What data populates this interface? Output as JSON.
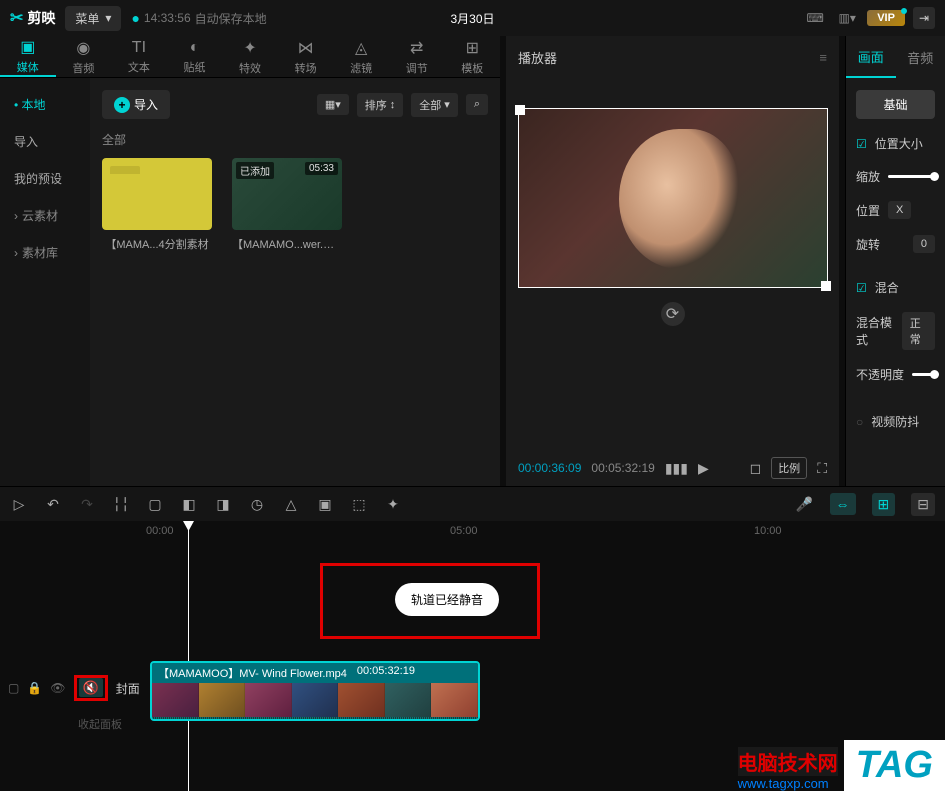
{
  "topbar": {
    "app_name": "剪映",
    "menu_label": "菜单",
    "autosave_time": "14:33:56",
    "autosave_text": "自动保存本地",
    "date": "3月30日",
    "vip": "VIP"
  },
  "tabs": [
    {
      "icon": "▣",
      "label": "媒体"
    },
    {
      "icon": "◉",
      "label": "音频"
    },
    {
      "icon": "TI",
      "label": "文本"
    },
    {
      "icon": "◐",
      "label": "贴纸"
    },
    {
      "icon": "✦",
      "label": "特效"
    },
    {
      "icon": "⋈",
      "label": "转场"
    },
    {
      "icon": "◬",
      "label": "滤镜"
    },
    {
      "icon": "⇄",
      "label": "调节"
    },
    {
      "icon": "⊞",
      "label": "模板"
    }
  ],
  "sidebar": {
    "local": "本地",
    "items": [
      "导入",
      "我的预设"
    ],
    "cloud": "云素材",
    "library": "素材库"
  },
  "media": {
    "import": "导入",
    "sort": "排序",
    "all_filter": "全部",
    "all_label": "全部",
    "items": [
      {
        "type": "folder",
        "name": "【MAMA...4分割素材"
      },
      {
        "type": "video",
        "name": "【MAMAMO...wer.mp4",
        "badge": "已添加",
        "duration": "05:33"
      }
    ]
  },
  "player": {
    "title": "播放器",
    "current": "00:00:36:09",
    "total": "00:05:32:19",
    "ratio": "比例"
  },
  "inspector": {
    "tabs": [
      "画面",
      "音频"
    ],
    "basic": "基础",
    "position_size": "位置大小",
    "scale": "缩放",
    "position": "位置",
    "pos_x": "X",
    "rotation": "旋转",
    "rotation_val": "0",
    "blend": "混合",
    "blend_mode": "混合模式",
    "blend_normal": "正常",
    "opacity": "不透明度",
    "stabilize": "视频防抖"
  },
  "timeline": {
    "ticks": [
      "00:00",
      "05:00",
      "10:00"
    ],
    "pill": "轨道已经静音",
    "cover": "封面",
    "collapse": "收起面板",
    "clip_name": "【MAMAMOO】MV- Wind Flower.mp4",
    "clip_dur": "00:05:32:19"
  },
  "watermark": {
    "text": "电脑技术网",
    "url": "www.tagxp.com",
    "tag": "TAG"
  }
}
